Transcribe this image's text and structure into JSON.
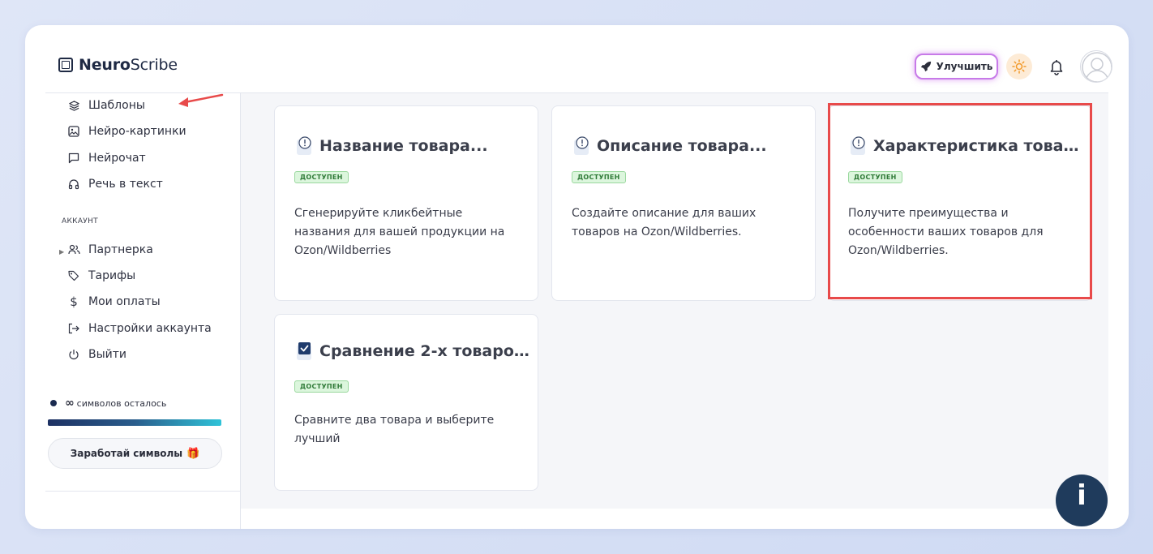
{
  "brand": {
    "name_bold": "Neuro",
    "name_rest": "Scribe"
  },
  "header": {
    "upgrade_label": "Улучшить"
  },
  "sidebar": {
    "items": [
      {
        "label": "Шаблоны",
        "icon": "layers-icon"
      },
      {
        "label": "Нейро-картинки",
        "icon": "image-icon"
      },
      {
        "label": "Нейрочат",
        "icon": "chat-icon"
      },
      {
        "label": "Речь в текст",
        "icon": "headphones-icon"
      }
    ],
    "account_label": "АККАУНТ",
    "account_items": [
      {
        "label": "Партнерка",
        "icon": "users-icon"
      },
      {
        "label": "Тарифы",
        "icon": "tag-icon"
      },
      {
        "label": "Мои оплаты",
        "icon": "dollar-icon"
      },
      {
        "label": "Настройки аккаунта",
        "icon": "logout-arrow-icon"
      },
      {
        "label": "Выйти",
        "icon": "power-icon"
      }
    ],
    "symbols_value": "∞",
    "symbols_text": "символов осталось",
    "earn_label": "Заработай символы"
  },
  "cards": [
    {
      "title": "Название товара...",
      "badge": "ДОСТУПЕН",
      "desc": "Сгенерируйте кликбейтные названия для вашей продукции на Ozon/Wildberries"
    },
    {
      "title": "Описание товара...",
      "badge": "ДОСТУПЕН",
      "desc": "Создайте описание для ваших товаров на Ozon/Wildberries."
    },
    {
      "title": "Характеристика товар...",
      "badge": "ДОСТУПЕН",
      "desc": "Получите преимущества и особенности ваших товаров для Ozon/Wildberries."
    },
    {
      "title": "Сравнение 2-х товаро...",
      "badge": "ДОСТУПЕН",
      "desc": "Сравните два товара и выберите лучший"
    }
  ],
  "fab": {
    "label": "i"
  },
  "colors": {
    "highlight": "#e84a4a",
    "badge_bg": "#dcf6dd",
    "fab": "#1f3b5c"
  }
}
